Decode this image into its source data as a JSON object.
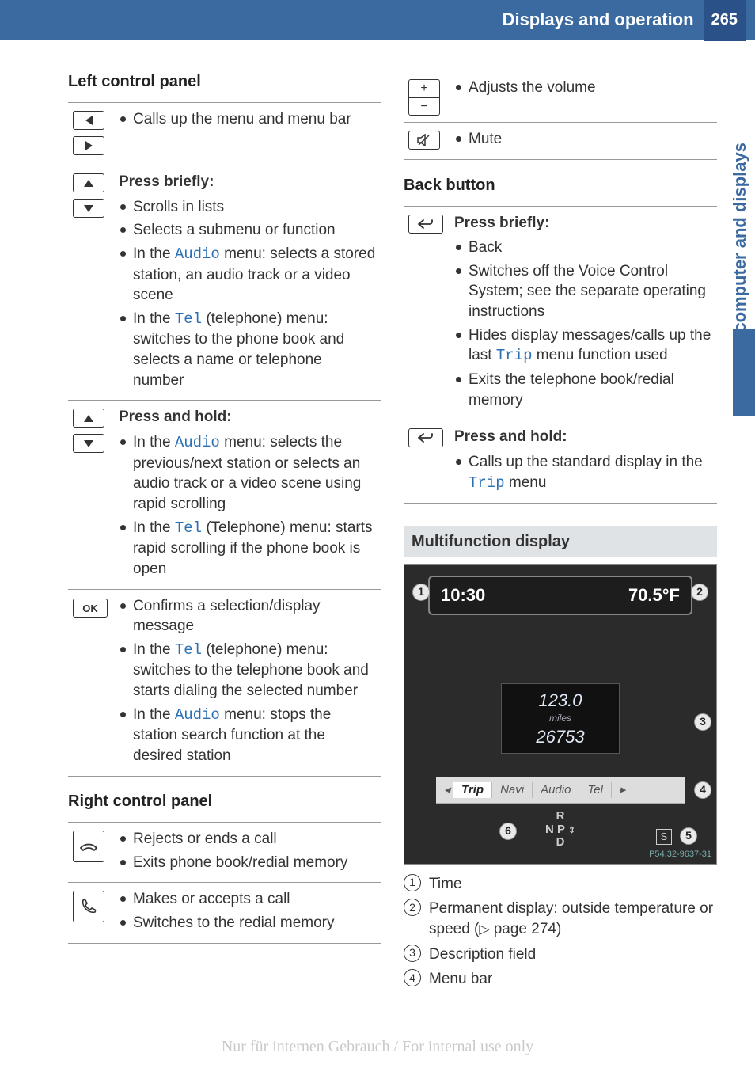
{
  "header": {
    "title": "Displays and operation",
    "page": "265"
  },
  "side_tab": "On-board computer and displays",
  "left_col": {
    "h_left": "Left control panel",
    "row1": {
      "items": [
        "Calls up the menu and menu bar"
      ]
    },
    "row2": {
      "subhead": "Press briefly:",
      "items": [
        "Scrolls in lists",
        "Selects a submenu or function",
        {
          "pre": "In the ",
          "link": "Audio",
          "post": " menu: selects a stored station, an audio track or a video scene"
        },
        {
          "pre": "In the ",
          "link": "Tel",
          "post": " (telephone) menu: switches to the phone book and selects a name or telephone number"
        }
      ]
    },
    "row3": {
      "subhead": "Press and hold:",
      "items": [
        {
          "pre": "In the ",
          "link": "Audio",
          "post": " menu: selects the previous/next station or selects an audio track or a video scene using rapid scrolling"
        },
        {
          "pre": "In the ",
          "link": "Tel",
          "post": " (Telephone) menu: starts rapid scrolling if the phone book is open"
        }
      ]
    },
    "row4": {
      "ok": "OK",
      "items": [
        "Confirms a selection/display message",
        {
          "pre": "In the ",
          "link": "Tel",
          "post": " (telephone) menu: switches to the telephone book and starts dialing the selected number"
        },
        {
          "pre": "In the ",
          "link": "Audio",
          "post": " menu: stops the station search function at the desired station"
        }
      ]
    },
    "h_right": "Right control panel",
    "row5": {
      "items": [
        "Rejects or ends a call",
        "Exits phone book/redial memory"
      ]
    },
    "row6": {
      "items": [
        "Makes or accepts a call",
        "Switches to the redial memory"
      ]
    }
  },
  "right_col": {
    "vol": "Adjusts the volume",
    "mute": "Mute",
    "h_back": "Back button",
    "back1": {
      "subhead": "Press briefly:",
      "items": [
        "Back",
        "Switches off the Voice Control System; see the separate operating instructions",
        {
          "pre": "Hides display messages/calls up the last ",
          "link": "Trip",
          "post": " menu function used"
        },
        "Exits the telephone book/redial memory"
      ]
    },
    "back2": {
      "subhead": "Press and hold:",
      "items": [
        {
          "pre": "Calls up the standard display in the ",
          "link": "Trip",
          "post": " menu"
        }
      ]
    },
    "h_multi": "Multifunction display",
    "display": {
      "time": "10:30",
      "temp": "70.5°F",
      "trip_dist": "123.0",
      "trip_unit": "miles",
      "odo": "26753",
      "menu": [
        "Trip",
        "Navi",
        "Audio",
        "Tel"
      ],
      "compass_top": "R",
      "compass_mid": "N P",
      "compass_bot": "D",
      "s_badge": "S",
      "imgnum": "P54.32-9637-31"
    },
    "callouts": [
      {
        "n": "1",
        "text": "Time"
      },
      {
        "n": "2",
        "text_pre": "Permanent display: outside temperature or speed (",
        "page_sym": "▷",
        "page": " page 274)",
        "text_post": ""
      },
      {
        "n": "3",
        "text": "Description field"
      },
      {
        "n": "4",
        "text": "Menu bar"
      }
    ]
  },
  "watermark": "Nur für internen Gebrauch / For internal use only"
}
